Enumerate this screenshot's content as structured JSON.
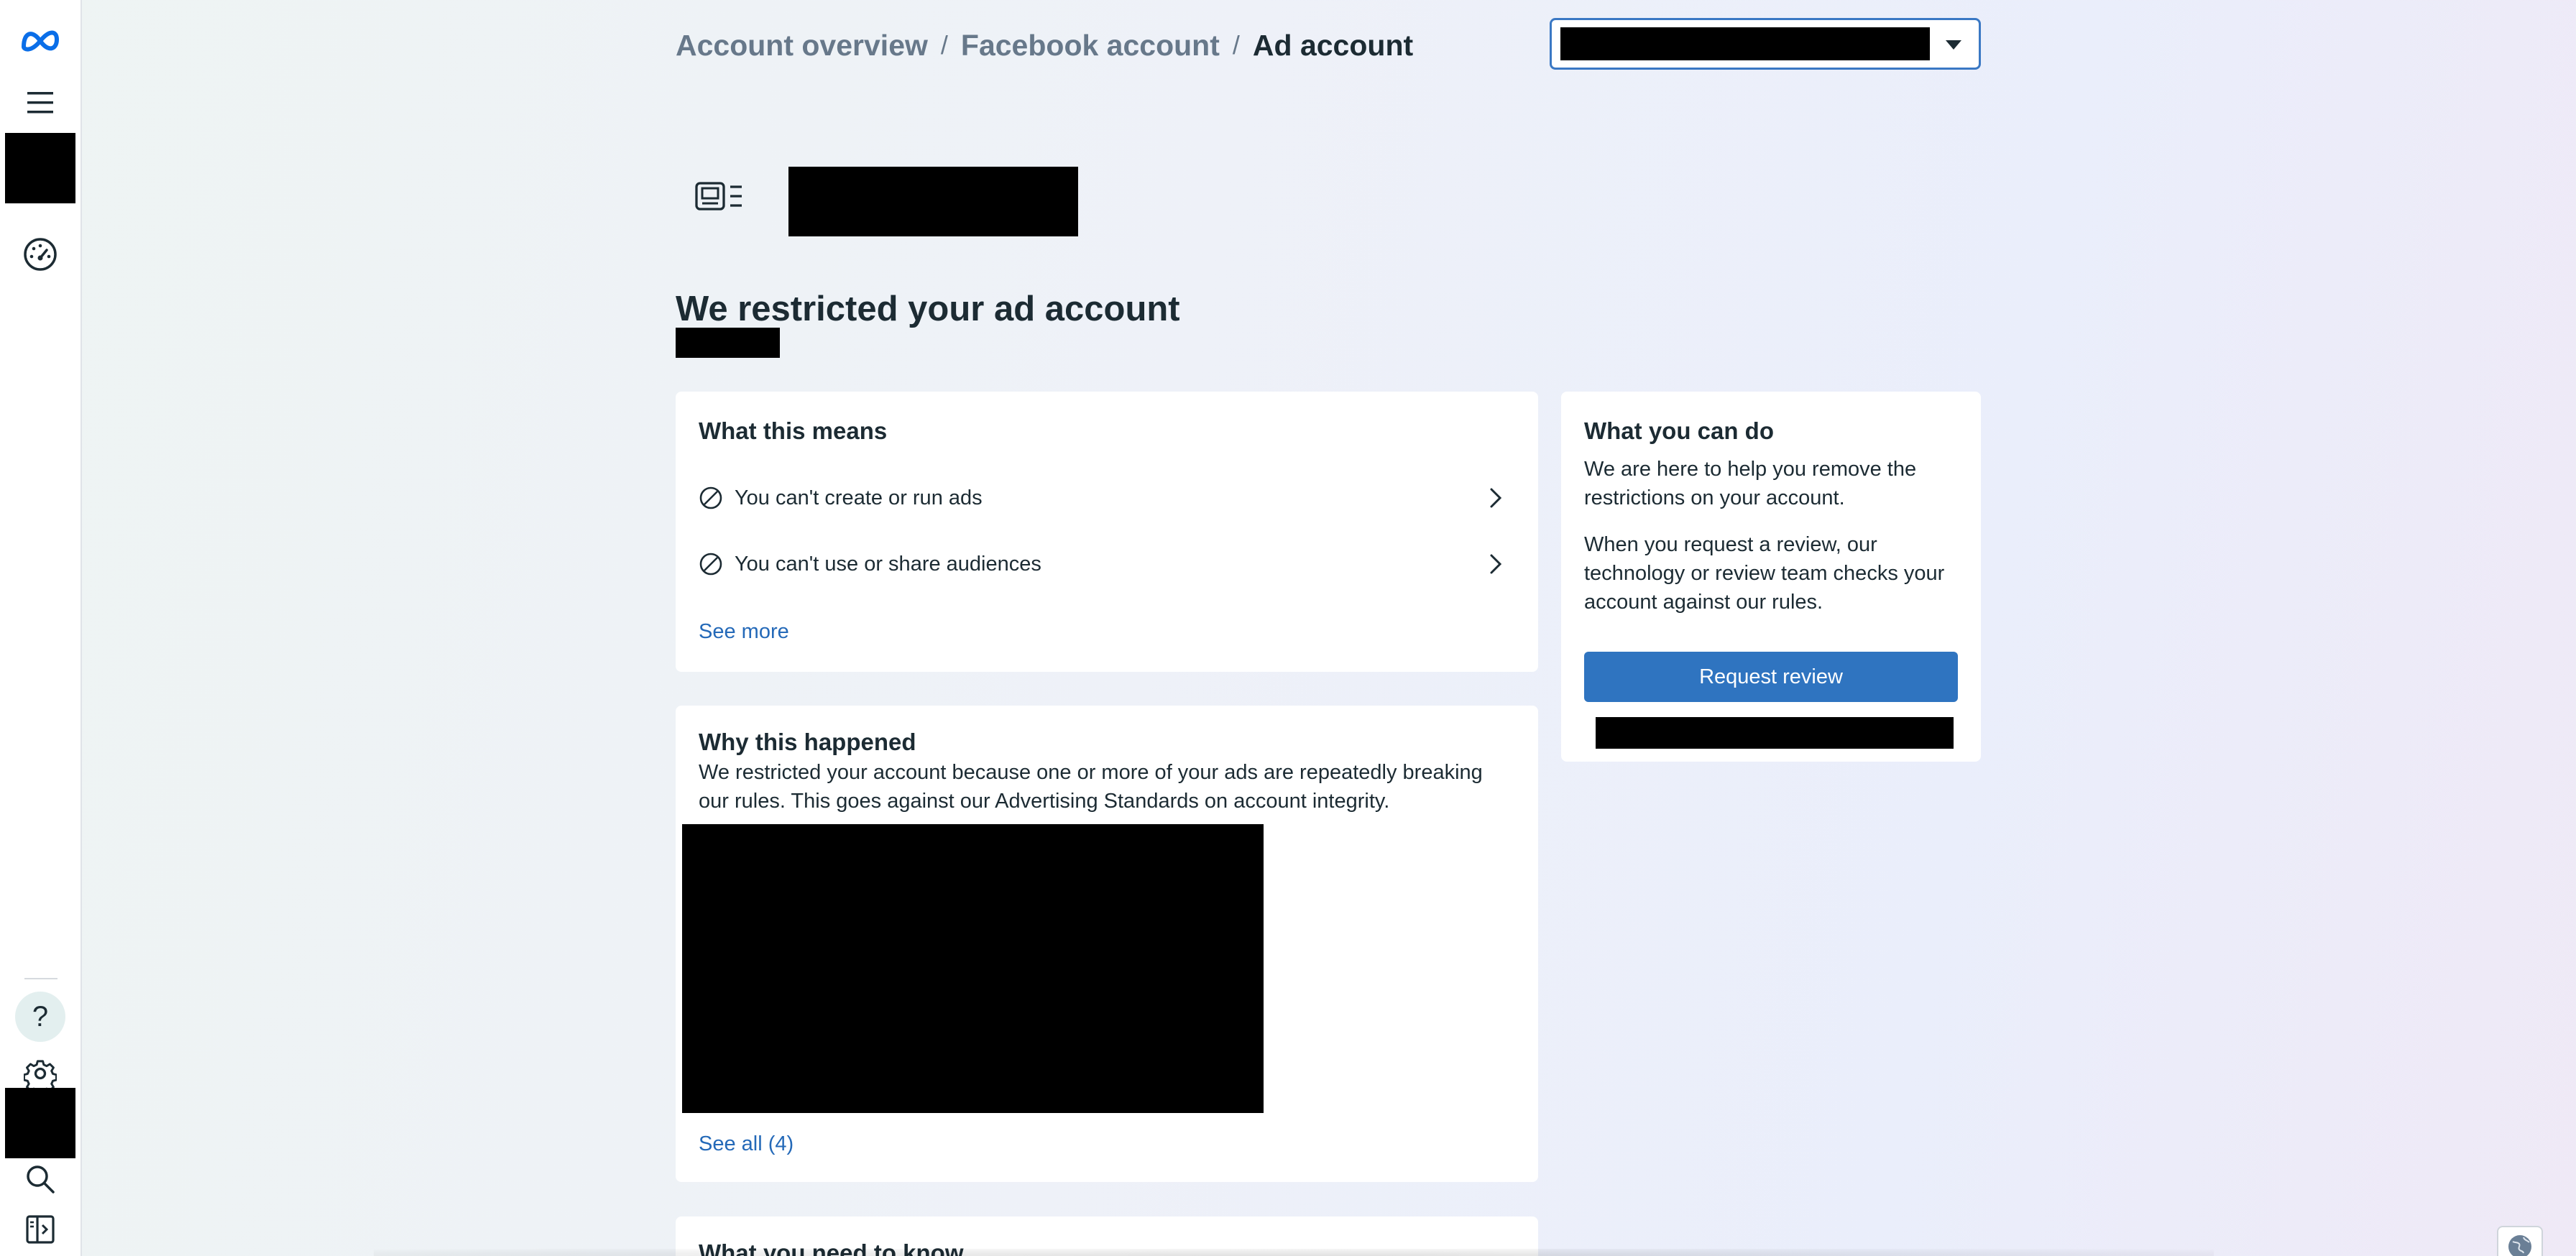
{
  "breadcrumb": {
    "items": [
      "Account overview",
      "Facebook account",
      "Ad account"
    ],
    "separator": "/"
  },
  "page": {
    "title": "We restricted your ad account"
  },
  "what_this_means": {
    "heading": "What this means",
    "items": [
      {
        "label": "You can't create or run ads"
      },
      {
        "label": "You can't use or share audiences"
      }
    ],
    "see_more": "See more"
  },
  "why_this_happened": {
    "heading": "Why this happened",
    "body": "We restricted your account because one or more of your ads are repeatedly breaking our rules. This goes against our Advertising Standards on account integrity.",
    "see_all": "See all (4)"
  },
  "what_you_need_to_know": {
    "heading": "What you need to know"
  },
  "what_you_can_do": {
    "heading": "What you can do",
    "para1": "We are here to help you remove the restrictions on your account.",
    "para2": "When you request a review, our technology or review team checks your account against our rules.",
    "request_review": "Request review"
  },
  "sidebar": {
    "help_glyph": "?"
  },
  "colors": {
    "accent": "#2f74c0",
    "link": "#2469b8",
    "text": "#1c2b33",
    "muted": "#67788a",
    "focus_border": "#3a78c4"
  },
  "icons": [
    "meta-logo-icon",
    "menu-icon",
    "speedometer-icon",
    "help-icon",
    "gear-icon",
    "search-icon",
    "sidebar-toggle-icon",
    "ad-account-icon",
    "ban-icon",
    "chevron-right-icon",
    "caret-down-icon",
    "globe-icon"
  ]
}
